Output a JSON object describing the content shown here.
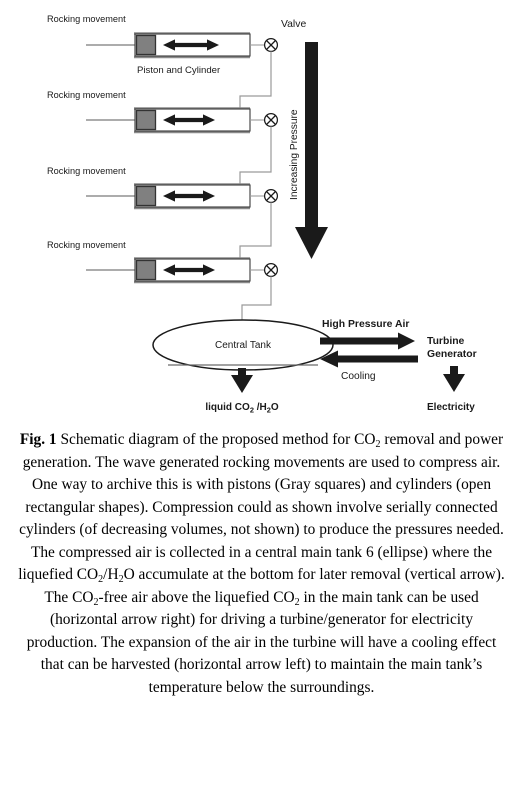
{
  "figure": {
    "id": "fig-1",
    "colors": {
      "ink": "#1a1a1a",
      "piston_fill": "#808080",
      "piston_stroke": "#333333",
      "cylinder_wall": "#8a8a8a",
      "pipe": "#9a9a9a",
      "arrow_black": "#1a1a1a",
      "background": "#ffffff"
    },
    "diagram": {
      "stages": [
        {
          "index": 1,
          "rocking_label": "Rocking movement",
          "valve_label": "Valve",
          "sublabel": "Piston and Cylinder"
        },
        {
          "index": 2,
          "rocking_label": "Rocking movement",
          "valve_label": "",
          "sublabel": ""
        },
        {
          "index": 3,
          "rocking_label": "Rocking movement",
          "valve_label": "",
          "sublabel": ""
        },
        {
          "index": 4,
          "rocking_label": "Rocking movement",
          "valve_label": "",
          "sublabel": ""
        }
      ],
      "pressure_arrow_label": "Increasing Pressure",
      "tank_label": "Central Tank",
      "outflow_label_prefix": "liquid CO",
      "outflow_label_sub1": "2",
      "outflow_label_mid": " /H",
      "outflow_label_sub2": "2",
      "outflow_label_suffix": "O",
      "high_pressure_air_label": "High Pressure Air",
      "cooling_label": "Cooling",
      "turbine_label_line1": "Turbine",
      "turbine_label_line2": "Generator",
      "electricity_label": "Electricity"
    },
    "caption": {
      "figure_number": "Fig. 1",
      "part1": " Schematic diagram of the proposed method for CO",
      "sub1": "2",
      "part2": " removal and power generation. The wave generated rocking movements are used to compress air. One way to archive this is with pistons (Gray squares) and cylinders (open rectangular shapes). Compression could as shown involve serially connected cylinders (of decreasing volumes, not shown) to produce the pressures needed. The compressed air is collected in a central main tank 6 (ellipse) where the liquefied CO",
      "sub2": "2",
      "part3": "/H",
      "sub3": "2",
      "part4": "O accumulate at the bottom for later removal (vertical arrow). The CO",
      "sub4": "2",
      "part5": "-free air above the liquefied CO",
      "sub5": "2",
      "part6": " in the main tank can be used (horizontal arrow right) for driving a turbine/generator for electricity production. The expansion of the air in the turbine will have a cooling effect that can be harvested (horizontal arrow left) to maintain the main tank’s temperature below the surroundings."
    }
  }
}
